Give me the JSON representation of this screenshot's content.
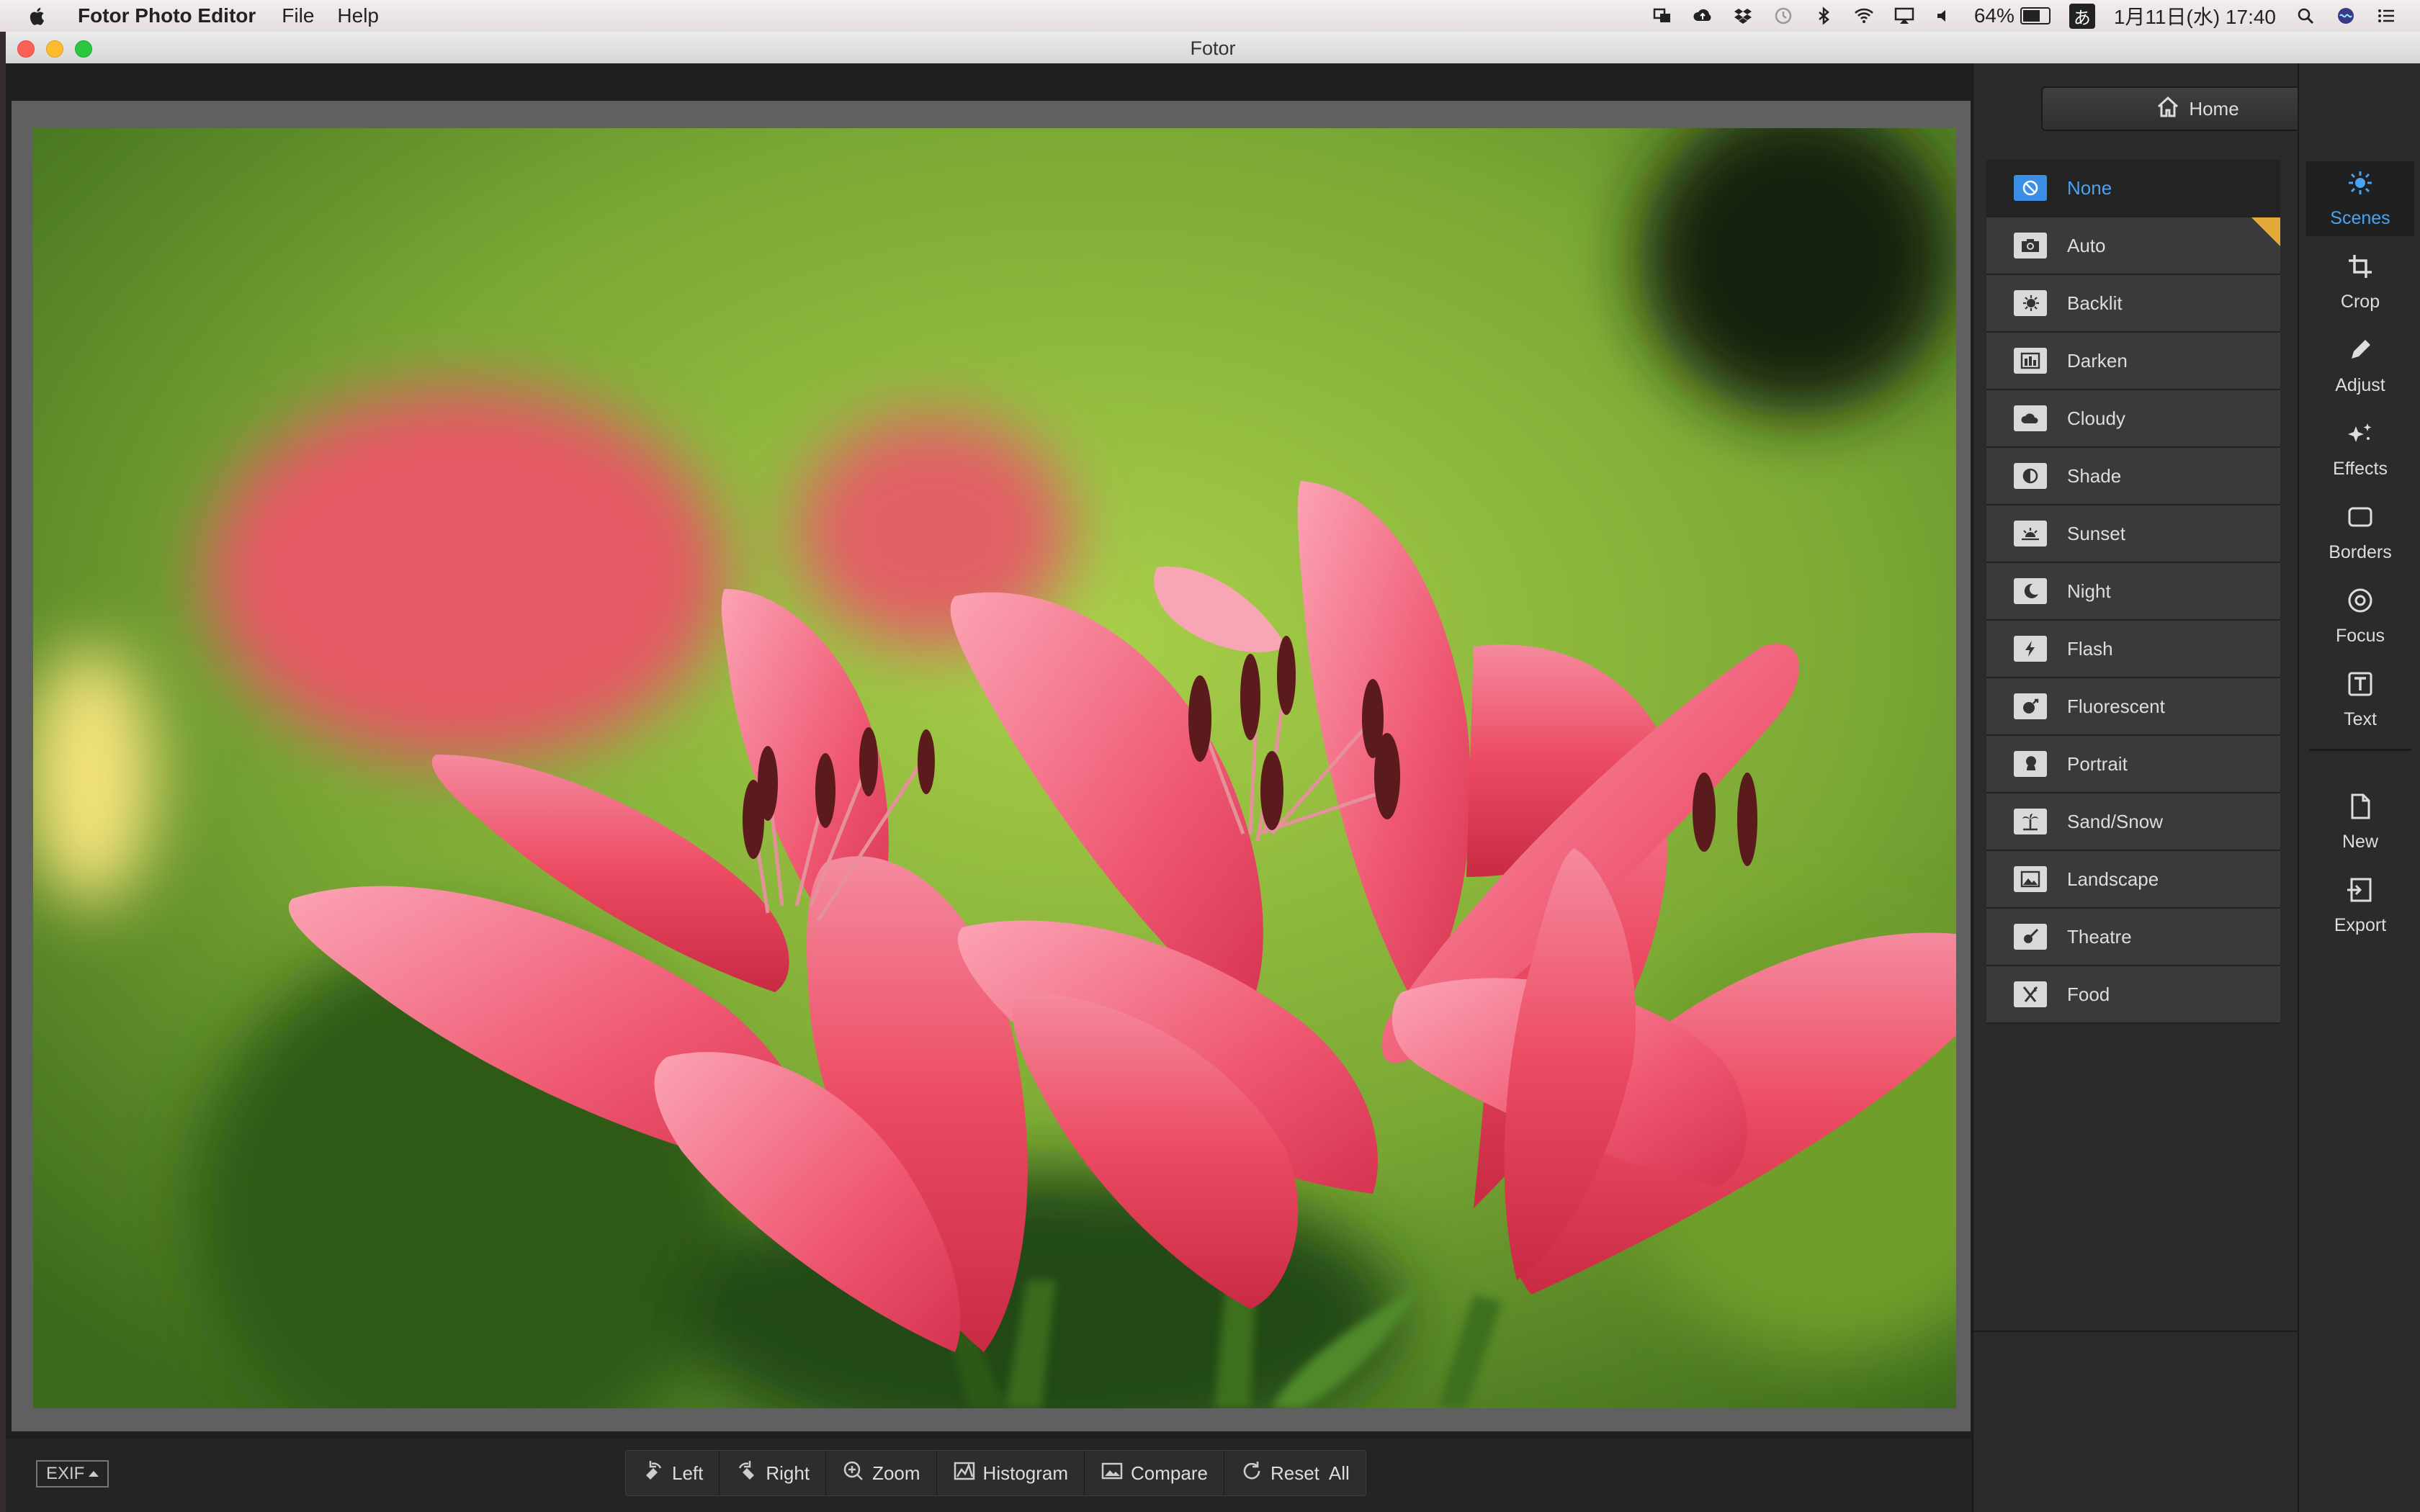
{
  "menubar": {
    "app_name": "Fotor Photo Editor",
    "menus": [
      "File",
      "Help"
    ],
    "battery_percent": "64%",
    "input_method": "あ",
    "datetime": "1月11日(水) 17:40"
  },
  "window": {
    "title": "Fotor"
  },
  "toolbar": {
    "exif_label": "EXIF",
    "tools": [
      {
        "label": "Left",
        "icon": "rotate-left-icon"
      },
      {
        "label": "Right",
        "icon": "rotate-right-icon"
      },
      {
        "label": "Zoom",
        "icon": "zoom-icon"
      },
      {
        "label": "Histogram",
        "icon": "histogram-icon"
      },
      {
        "label": "Compare",
        "icon": "compare-icon"
      },
      {
        "label": "Reset  All",
        "icon": "reset-icon"
      }
    ]
  },
  "home_button": {
    "label": "Home"
  },
  "scenes": [
    {
      "label": "None",
      "icon": "none-icon",
      "selected": true
    },
    {
      "label": "Auto",
      "icon": "camera-icon",
      "badge": true
    },
    {
      "label": "Backlit",
      "icon": "backlit-icon"
    },
    {
      "label": "Darken",
      "icon": "darken-icon"
    },
    {
      "label": "Cloudy",
      "icon": "cloud-icon"
    },
    {
      "label": "Shade",
      "icon": "shade-icon"
    },
    {
      "label": "Sunset",
      "icon": "sunset-icon"
    },
    {
      "label": "Night",
      "icon": "night-icon"
    },
    {
      "label": "Flash",
      "icon": "flash-icon"
    },
    {
      "label": "Fluorescent",
      "icon": "fluorescent-icon"
    },
    {
      "label": "Portrait",
      "icon": "portrait-icon"
    },
    {
      "label": "Sand/Snow",
      "icon": "palm-icon"
    },
    {
      "label": "Landscape",
      "icon": "landscape-icon"
    },
    {
      "label": "Theatre",
      "icon": "theatre-icon"
    },
    {
      "label": "Food",
      "icon": "food-icon"
    }
  ],
  "side_tools": [
    {
      "label": "Scenes",
      "icon": "sun-icon",
      "active": true
    },
    {
      "label": "Crop",
      "icon": "crop-icon"
    },
    {
      "label": "Adjust",
      "icon": "pencil-icon"
    },
    {
      "label": "Effects",
      "icon": "sparkle-icon"
    },
    {
      "label": "Borders",
      "icon": "border-icon"
    },
    {
      "label": "Focus",
      "icon": "focus-icon"
    },
    {
      "label": "Text",
      "icon": "text-icon"
    },
    {
      "label": "New",
      "icon": "new-file-icon"
    },
    {
      "label": "Export",
      "icon": "export-icon"
    }
  ],
  "colors": {
    "accent": "#4aa3f0",
    "selected_icon_bg": "#3a8ee6",
    "badge": "#e3a93a"
  }
}
